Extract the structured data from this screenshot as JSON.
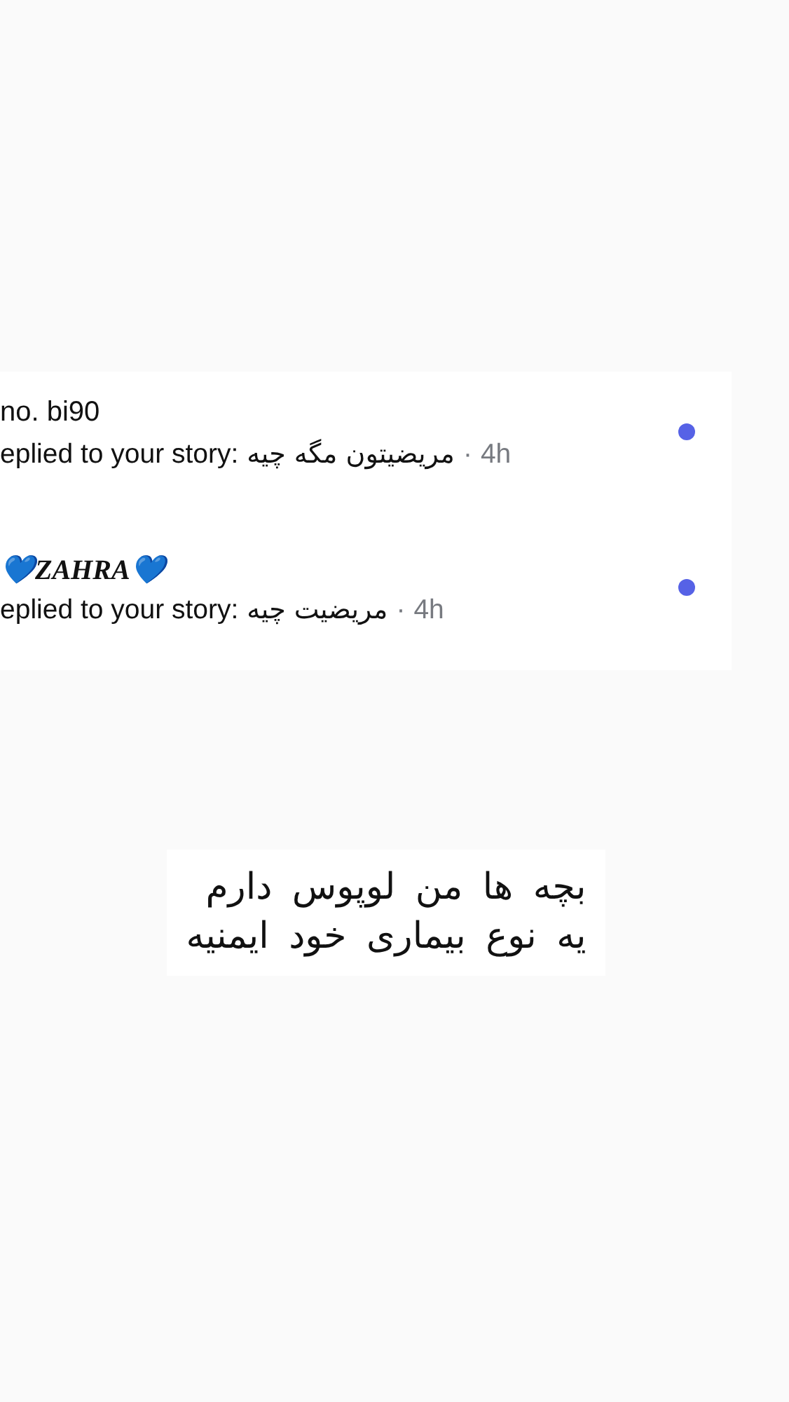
{
  "notifications": [
    {
      "name": "no. bi90",
      "action": "eplied to your story:",
      "message": "مریضیتون مگه چیه",
      "separator": "·",
      "time": "4h",
      "unread": true
    },
    {
      "name": "💙ZAHRA💙",
      "action": "eplied to your story:",
      "message": "مریضیت چیه",
      "separator": "·",
      "time": "4h",
      "unread": true
    }
  ],
  "caption": {
    "lines": [
      "بچه ها من لوپوس دارم",
      "یه نوع بیماری خود ایمنیه"
    ]
  }
}
